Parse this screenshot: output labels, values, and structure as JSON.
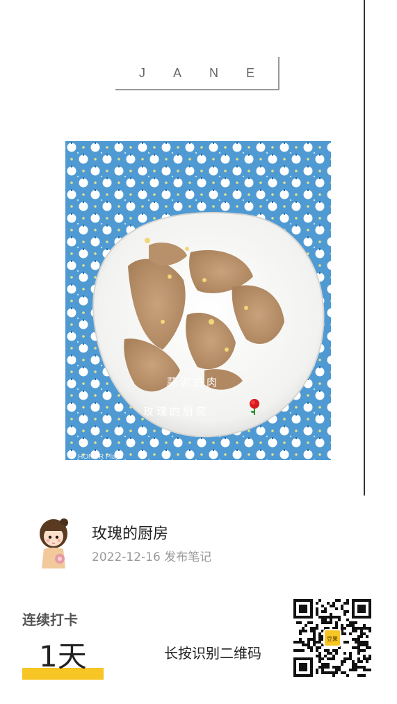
{
  "brand": {
    "text": "JANE"
  },
  "photo": {
    "overlay_title": "蒜泥白肉",
    "overlay_author": "玫瑰的厨房",
    "watermark": "HONOR Play3"
  },
  "profile": {
    "name": "玫瑰的厨房",
    "date_text": "2022-12-16 发布笔记"
  },
  "streak": {
    "label": "连续打卡",
    "value": "1天"
  },
  "qr": {
    "hint": "长按识别二维码",
    "badge": "豆果"
  },
  "colors": {
    "accent": "#f7c524",
    "tablecloth": "#4a9ad4"
  },
  "icons": [
    "rose-icon",
    "avatar-girl-icon"
  ]
}
